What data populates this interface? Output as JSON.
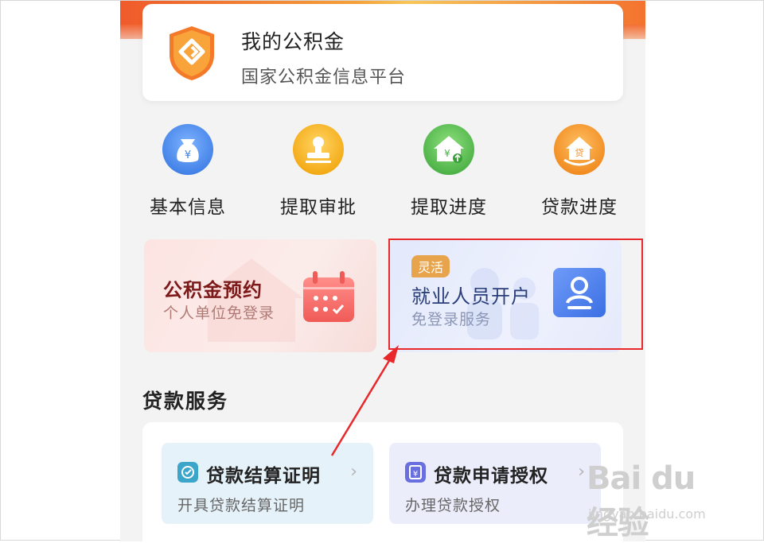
{
  "header_card": {
    "title": "我的公积金",
    "subtitle": "国家公积金信息平台"
  },
  "quick_actions": [
    {
      "label": "基本信息",
      "icon": "money-bag-icon",
      "color": "#4a8df0"
    },
    {
      "label": "提取审批",
      "icon": "stamp-icon",
      "color": "#f5b325"
    },
    {
      "label": "提取进度",
      "icon": "house-yuan-icon",
      "color": "#5dbf5a"
    },
    {
      "label": "贷款进度",
      "icon": "loan-house-icon",
      "color": "#f59a2c"
    }
  ],
  "promo_left": {
    "title": "公积金预约",
    "subtitle": "个人单位免登录"
  },
  "promo_right": {
    "tag": "灵活",
    "title": "就业人员开户",
    "subtitle": "免登录服务"
  },
  "loan_section": {
    "title": "贷款服务",
    "services": [
      {
        "title": "贷款结算证明",
        "subtitle": "开具贷款结算证明",
        "chevron": "›"
      },
      {
        "title": "贷款申请授权",
        "subtitle": "办理贷款授权",
        "chevron": "›"
      }
    ]
  },
  "watermark": {
    "main": "Bai du 经验",
    "url": "jingyan.baidu.com"
  },
  "colors": {
    "highlight": "#e8282a",
    "accent_orange": "#f5a623",
    "loan_blue": "#3d7ee8"
  }
}
